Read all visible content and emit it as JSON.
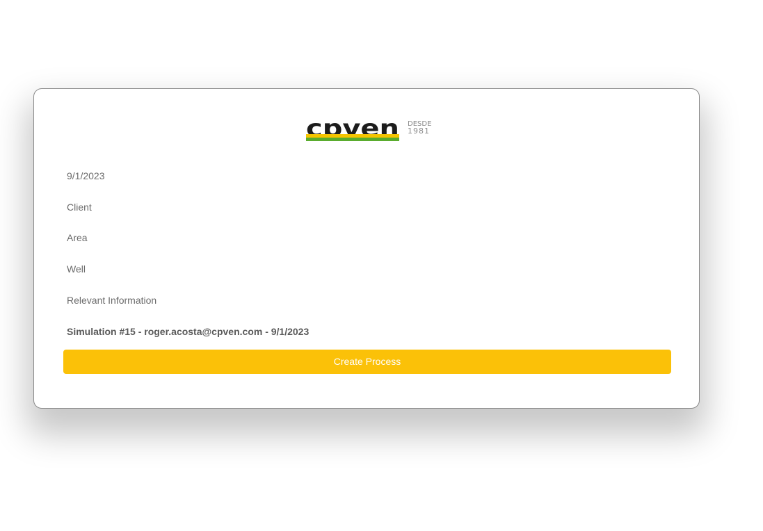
{
  "logo": {
    "wordmark": "cpven",
    "tagline_top": "DESDE",
    "tagline_bottom": "1981",
    "colors": {
      "wordmark": "#1c1c1c",
      "stripe_yellow": "#f5c400",
      "stripe_green": "#5aac2e",
      "tagline": "#8a8a8a"
    }
  },
  "form": {
    "date": "9/1/2023",
    "client_label": "Client",
    "area_label": "Area",
    "well_label": "Well",
    "relevant_info_label": "Relevant Information",
    "summary": "Simulation #15 - roger.acosta@cpven.com - 9/1/2023"
  },
  "actions": {
    "create_label": "Create Process"
  },
  "colors": {
    "button": "#fbc108",
    "button_text": "#ffffff",
    "text_muted": "#6b6b6b"
  }
}
